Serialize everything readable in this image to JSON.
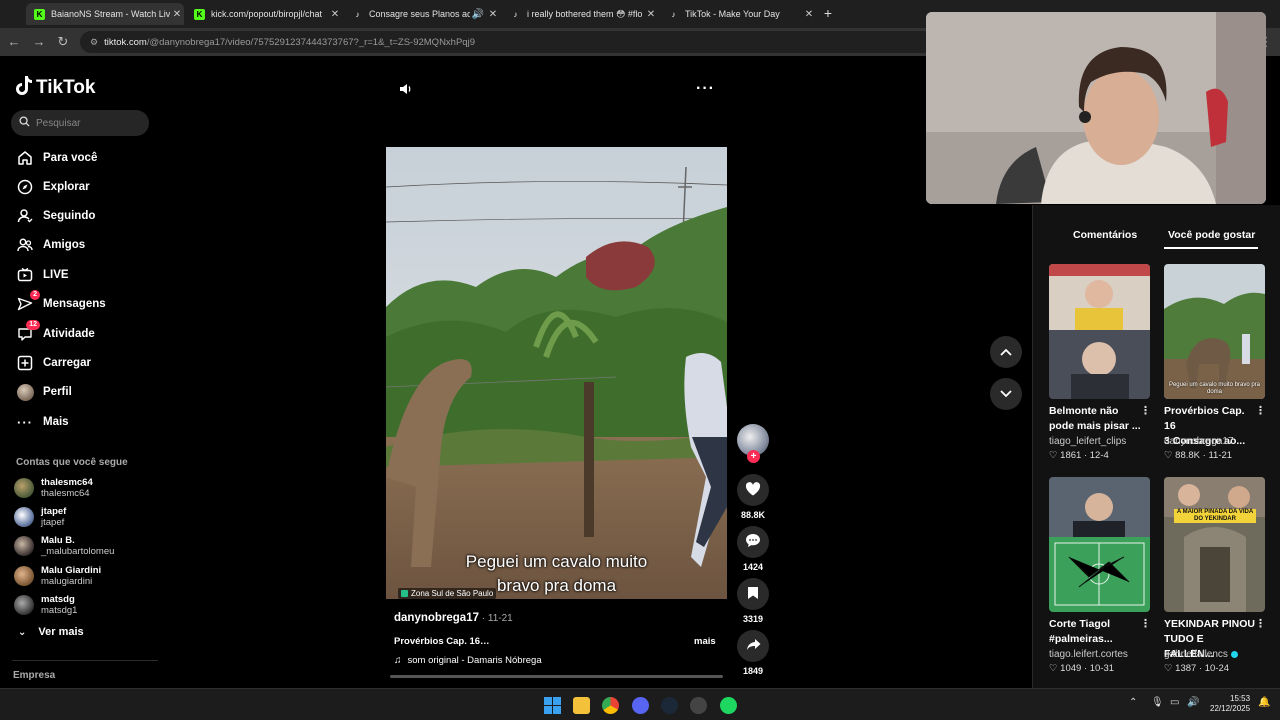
{
  "browser": {
    "tabs": [
      {
        "title": "BaianoNS Stream - Watch Live o",
        "favicon": "K",
        "active": true
      },
      {
        "title": "kick.com/popout/biropjl/chat",
        "favicon": "K",
        "active": false
      },
      {
        "title": "Consagre seus Planos ao Se",
        "favicon": "tiktok-icon",
        "active": false
      },
      {
        "title": "i really bothered them 😳 #flo",
        "favicon": "tiktok-icon",
        "active": false
      },
      {
        "title": "TikTok - Make Your Day",
        "favicon": "tiktok-icon",
        "active": false
      }
    ],
    "url_host": "tiktok.com",
    "url_path": "/@danynobrega17/video/7575291237444373767?_r=1&_t=ZS-92MQNxhPqj9"
  },
  "sidebar": {
    "logo": "TikTok",
    "search_placeholder": "Pesquisar",
    "nav": [
      {
        "label": "Para você",
        "icon": "home-icon"
      },
      {
        "label": "Explorar",
        "icon": "compass-icon"
      },
      {
        "label": "Seguindo",
        "icon": "following-icon"
      },
      {
        "label": "Amigos",
        "icon": "friends-icon"
      },
      {
        "label": "LIVE",
        "icon": "live-icon"
      },
      {
        "label": "Mensagens",
        "icon": "messages-icon",
        "badge": "2"
      },
      {
        "label": "Atividade",
        "icon": "activity-icon",
        "badge": "12"
      },
      {
        "label": "Carregar",
        "icon": "upload-icon"
      },
      {
        "label": "Perfil",
        "icon": "profile-avatar"
      },
      {
        "label": "Mais",
        "icon": "more-icon"
      }
    ],
    "following_heading": "Contas que você segue",
    "following": [
      {
        "name": "thalesmc64",
        "handle": "thalesmc64"
      },
      {
        "name": "jtapef",
        "handle": "jtapef"
      },
      {
        "name": "Malu B.",
        "handle": "_malubartolomeu"
      },
      {
        "name": "Malu Giardini",
        "handle": "malugiardini"
      },
      {
        "name": "matsdg",
        "handle": "matsdg1"
      }
    ],
    "see_more": "Ver mais",
    "footer": "Empresa"
  },
  "player": {
    "subtitle_line1": "Peguei um cavalo muito",
    "subtitle_line2": "bravo pra doma",
    "location": "Zona Sul de São Paulo",
    "author": "danynobrega17",
    "date": "11-21",
    "description": "Provérbios Cap. 16…",
    "more_label": "mais",
    "sound": "som original - Damaris Nóbrega",
    "progress": 0.0
  },
  "actions": {
    "likes": "88.8K",
    "comments": "1424",
    "saves": "3319",
    "shares": "1849"
  },
  "right_panel": {
    "tabs": [
      "Comentários",
      "Você pode gostar"
    ],
    "active_tab": "Você pode gostar",
    "cards": [
      {
        "title_line1": "Belmonte não",
        "title_line2": "pode mais pisar ...",
        "author": "tiago_leifert_clips",
        "likes": "1861",
        "date": "12-4",
        "verified": false,
        "thumb_caption": ""
      },
      {
        "title_line1": "Provérbios Cap. 16",
        "title_line2": "3 Consagre ao...",
        "author": "danynobrega17",
        "likes": "88.8K",
        "date": "11-21",
        "verified": false,
        "thumb_caption": "Peguei um cavalo muito bravo pra doma"
      },
      {
        "title_line1": "Corte Tiagol",
        "title_line2": "#palmeiras...",
        "author": "tiago.leifert.cortes",
        "likes": "1049",
        "date": "10-31",
        "verified": false,
        "thumb_caption": ""
      },
      {
        "title_line1": "YEKINDAR PINOU",
        "title_line2": "TUDO E FALLEN...",
        "author": "gabrielfallencs",
        "likes": "1387",
        "date": "10-24",
        "verified": true,
        "thumb_caption": "A MAIOR PINADA DA VIDA DO YEKINDAR"
      }
    ]
  },
  "taskbar": {
    "time": "15:53",
    "date": "22/12/2025"
  },
  "colors": {
    "accent": "#fe2c55",
    "background": "#000000",
    "panel": "#121212"
  }
}
